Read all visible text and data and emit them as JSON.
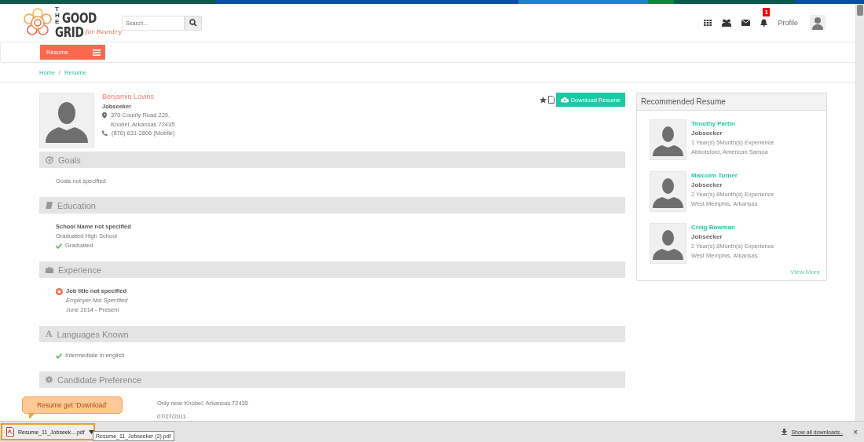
{
  "header": {
    "logo": {
      "the": "THE",
      "good": "GOOD",
      "grid": "GRID",
      "tagline": "for Reentry"
    },
    "search": {
      "placeholder": "Search..."
    },
    "notification_count": "1",
    "profile_label": "Profile"
  },
  "nav": {
    "menu_button": "Resume"
  },
  "breadcrumb": {
    "items": [
      {
        "label": "Home"
      },
      {
        "label": "Resume"
      }
    ],
    "separator": "/"
  },
  "profile": {
    "name": "Benjamin Lovins",
    "role": "Jobseeker",
    "address_lines": [
      "370 County Road 229,",
      "Knobel, Arkansas  72435"
    ],
    "phone": "(870) 631-2806 (Mobile)",
    "download_button": "Download Resume"
  },
  "sections": [
    {
      "kind": "goals",
      "title": "Goals",
      "items": [
        {
          "kind": "plain",
          "text": "Goals not specified"
        }
      ]
    },
    {
      "kind": "education",
      "title": "Education",
      "items": [
        {
          "kind": "bold",
          "text": "School Name not specified"
        },
        {
          "kind": "plain",
          "text": "Graduated High School"
        },
        {
          "kind": "check",
          "text": "Graduated"
        }
      ]
    },
    {
      "kind": "experience",
      "title": "Experience",
      "items": [
        {
          "kind": "alert",
          "text": "Job title not specified"
        },
        {
          "kind": "italic",
          "text": "Employer Not Specified"
        },
        {
          "kind": "plain",
          "text": "June 2014 - Present"
        }
      ]
    },
    {
      "kind": "languages",
      "title": "Languages Known",
      "icon_text": "A",
      "items": [
        {
          "kind": "check",
          "text": "Intermediate in english"
        }
      ]
    },
    {
      "kind": "preference",
      "title": "Candidate Preference",
      "items": [
        {
          "kind": "indented",
          "text": "Only near Knobel, Arkansas 72435"
        },
        {
          "kind": "indented",
          "text": "07/27/2011"
        }
      ]
    }
  ],
  "recommended": {
    "title": "Recommended Resume",
    "items": [
      {
        "name": "Timothy Partin",
        "role": "Jobseeker",
        "experience": "1 Year(s) 5Month(s) Experience",
        "location": "Abbotsford, American Samoa"
      },
      {
        "name": "Malcolm Turner",
        "role": "Jobseeker",
        "experience": "2 Year(s) 8Month(s) Experience",
        "location": "West Memphis, Arkansas"
      },
      {
        "name": "Creig Bowman",
        "role": "Jobseeker",
        "experience": "2 Year(s) 8Month(s) Experience",
        "location": "West Memphis, Arkansas"
      }
    ],
    "view_more": "View More"
  },
  "callout": "Resume get ‘Download’",
  "download_bar": {
    "file": "Resume_11_Jobseek....pdf",
    "tooltip": "Resume_11_Jobseeker (2).pdf",
    "show_all": "Show all downloads..",
    "close": "×"
  }
}
